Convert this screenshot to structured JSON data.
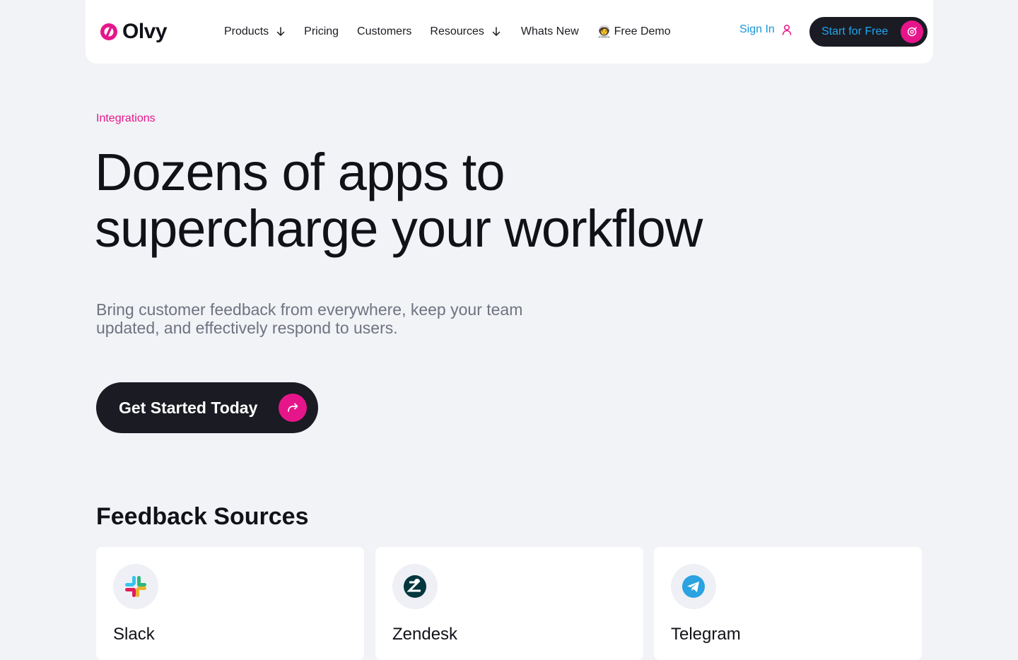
{
  "brand": {
    "name": "Olvy",
    "accent": "#e6168a",
    "link_blue": "#1797d8"
  },
  "nav": {
    "items": [
      {
        "label": "Products",
        "has_dropdown": true
      },
      {
        "label": "Pricing",
        "has_dropdown": false
      },
      {
        "label": "Customers",
        "has_dropdown": false
      },
      {
        "label": "Resources",
        "has_dropdown": true
      },
      {
        "label": "Whats New",
        "has_dropdown": false
      },
      {
        "label": "Free Demo",
        "emoji": "🧑‍🚀",
        "has_dropdown": false
      }
    ],
    "sign_in": "Sign In",
    "start_free": "Start for Free"
  },
  "hero": {
    "eyebrow": "Integrations",
    "headline_line1": "Dozens of apps to",
    "headline_line2": "supercharge your workflow",
    "sub_line1": "Bring customer feedback from everywhere, keep your team",
    "sub_line2": "updated, and effectively respond to users.",
    "cta": "Get Started Today"
  },
  "feedback_sources": {
    "title": "Feedback Sources",
    "cards": [
      {
        "name": "Slack",
        "icon": "slack-icon"
      },
      {
        "name": "Zendesk",
        "icon": "zendesk-icon"
      },
      {
        "name": "Telegram",
        "icon": "telegram-icon"
      }
    ]
  }
}
